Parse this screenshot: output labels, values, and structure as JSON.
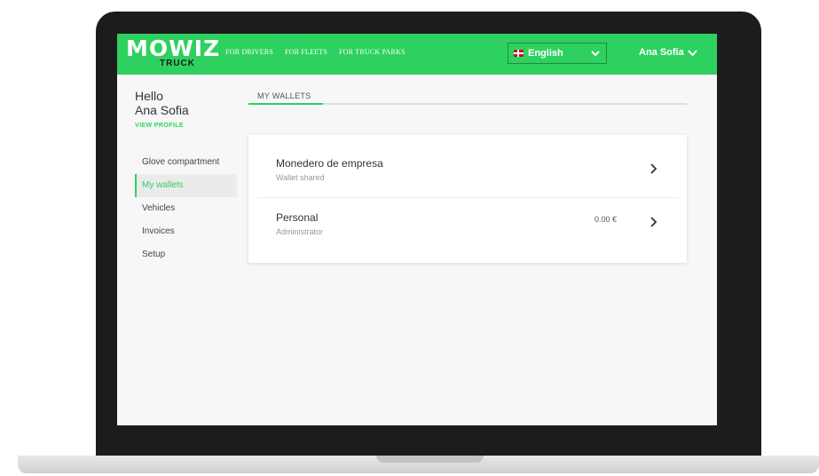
{
  "header": {
    "logo_main": "MOWIZ",
    "logo_sub": "TRUCK",
    "nav": [
      "FOR DRIVERS",
      "FOR FLEETS",
      "FOR TRUCK PARKS"
    ],
    "language": "English",
    "user": "Ana Sofia"
  },
  "profile": {
    "greeting_line1": "Hello",
    "greeting_line2": "Ana Sofia",
    "view_profile": "VIEW PROFILE"
  },
  "sidebar": {
    "items": [
      {
        "label": "Glove compartment",
        "active": false
      },
      {
        "label": "My wallets",
        "active": true
      },
      {
        "label": "Vehicles",
        "active": false
      },
      {
        "label": "Invoices",
        "active": false
      },
      {
        "label": "Setup",
        "active": false
      }
    ]
  },
  "tabs": [
    {
      "label": "MY WALLETS",
      "active": true
    }
  ],
  "wallets": [
    {
      "name": "Monedero de empresa",
      "role": "Wallet shared",
      "amount": ""
    },
    {
      "name": "Personal",
      "role": "Administrator",
      "amount": "0.00 €"
    }
  ],
  "colors": {
    "brand": "#2ed15f",
    "text": "#333333",
    "muted": "#999999"
  },
  "icons": [
    "chevron-down-icon",
    "chevron-right-icon",
    "uk-flag-icon"
  ]
}
